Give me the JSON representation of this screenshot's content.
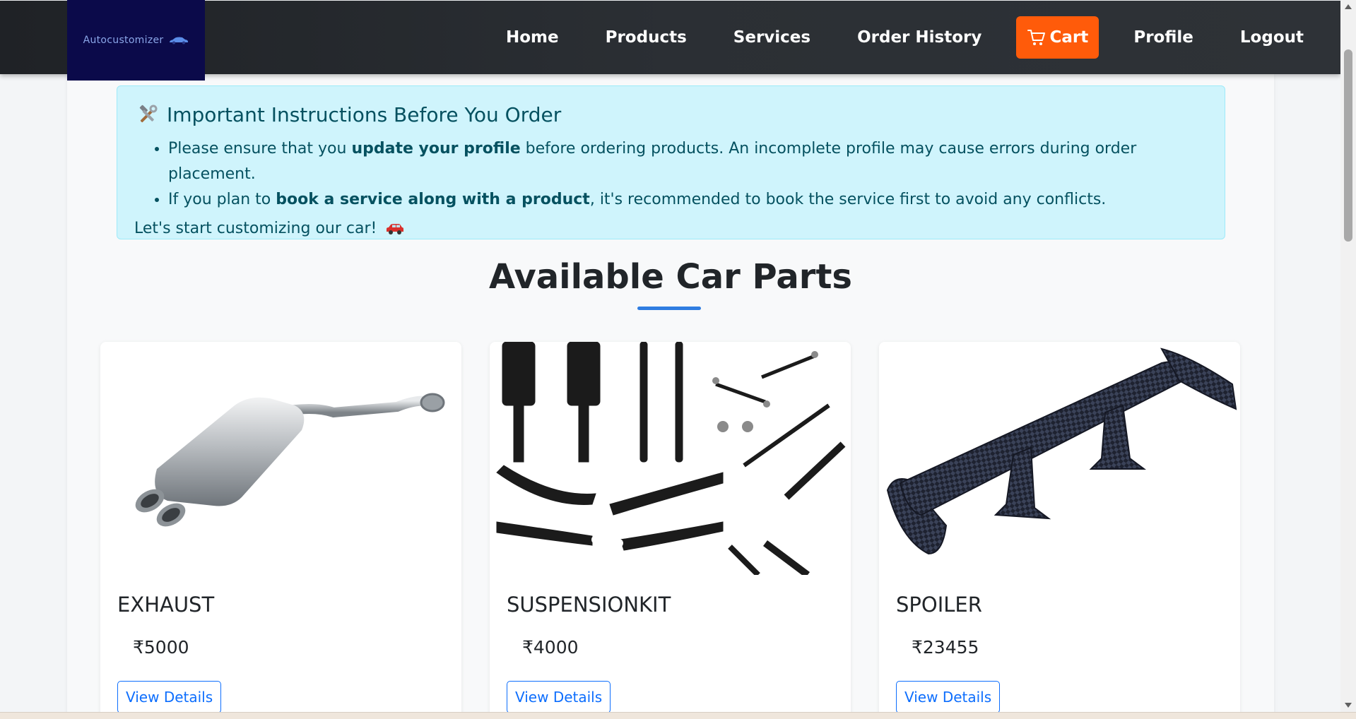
{
  "brand": {
    "name": "Autocustomizer",
    "logo_icon": "car-icon",
    "logo_bg": "#0b0a4a"
  },
  "nav": {
    "items": [
      {
        "label": "Home"
      },
      {
        "label": "Products"
      },
      {
        "label": "Services"
      },
      {
        "label": "Order History"
      }
    ],
    "cart_label": "Cart",
    "cart_color": "#ff5b0a",
    "profile_label": "Profile",
    "logout_label": "Logout"
  },
  "alert": {
    "heading": "Important Instructions Before You Order",
    "heading_icon": "hammer-wrench-icon",
    "items": [
      {
        "before": "Please ensure that you ",
        "bold": "update your profile",
        "after": " before ordering products. An incomplete profile may cause errors during order placement."
      },
      {
        "before": "If you plan to ",
        "bold": "book a service along with a product",
        "after": ", it's recommended to book the service first to avoid any conflicts."
      }
    ],
    "footer": "Let's start customizing our car!",
    "footer_icon": "red-car-icon"
  },
  "section": {
    "title": "Available Car Parts",
    "accent": "#2f7de1"
  },
  "products": [
    {
      "name": "EXHAUST",
      "price": "₹5000",
      "button": "View Details",
      "image": "exhaust-muffler-image"
    },
    {
      "name": "SUSPENSIONKIT",
      "price": "₹4000",
      "button": "View Details",
      "image": "suspension-kit-image"
    },
    {
      "name": "SPOILER",
      "price": "₹23455",
      "button": "View Details",
      "image": "carbon-spoiler-image"
    }
  ]
}
